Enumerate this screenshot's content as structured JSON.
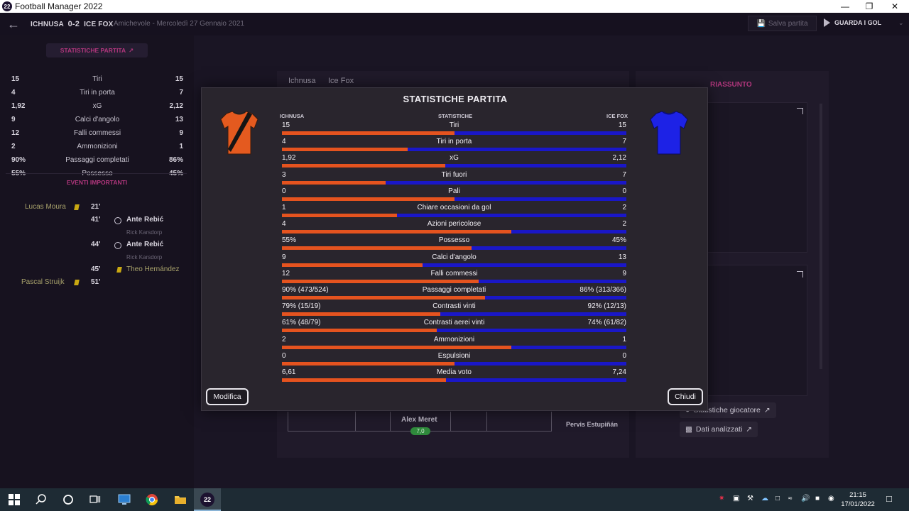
{
  "window": {
    "title": "Football Manager 2022",
    "logo_text": "22",
    "controls": [
      "—",
      "❐",
      "✕"
    ]
  },
  "topbar": {
    "home_team": "ICHNUSA",
    "score": "0-2",
    "away_team": "ICE FOX",
    "subtitle": "Amichevole - Mercoledì 27 Gennaio 2021",
    "save_label": "Salva partita",
    "watch_label": "GUARDA I GOL"
  },
  "left_panel": {
    "header": "STATISTICHE PARTITA",
    "stats": [
      {
        "home": "15",
        "label": "Tiri",
        "away": "15"
      },
      {
        "home": "4",
        "label": "Tiri in porta",
        "away": "7"
      },
      {
        "home": "1,92",
        "label": "xG",
        "away": "2,12"
      },
      {
        "home": "9",
        "label": "Calci d'angolo",
        "away": "13"
      },
      {
        "home": "12",
        "label": "Falli commessi",
        "away": "9"
      },
      {
        "home": "2",
        "label": "Ammonizioni",
        "away": "1"
      },
      {
        "home": "90%",
        "label": "Passaggi completati",
        "away": "86%"
      },
      {
        "home": "55%",
        "label": "Possesso",
        "away": "45%"
      }
    ],
    "events_header": "EVENTI IMPORTANTI",
    "events": [
      {
        "player": "Lucas Moura",
        "minute": "21'"
      },
      {
        "minute": "41'",
        "player": "Ante Rebić",
        "assist": "Rick Karsdorp"
      },
      {
        "minute": "44'",
        "player": "Ante Rebić",
        "assist": "Rick Karsdorp"
      },
      {
        "minute": "45'",
        "player": "Theo Hernández"
      },
      {
        "player": "Pascal Struijk",
        "minute": "51'"
      }
    ]
  },
  "middle": {
    "tabs": [
      "Ichnusa",
      "Ice Fox"
    ],
    "keeper_name": "Alex Meret",
    "keeper_rating": "7,0",
    "other_player": "Pervis Estupiñán"
  },
  "right_panel": {
    "title": "RIASSUNTO",
    "btn_player_stats": "Statistiche giocatore",
    "btn_analysis": "Dati analizzati"
  },
  "dialog": {
    "title": "STATISTICHE PARTITA",
    "home_header": "ICHNUSA",
    "middle_header": "STATISTICHE",
    "away_header": "ICE FOX",
    "home_color": "#e5531f",
    "away_color": "#1a17c8",
    "rows": [
      {
        "home": "15",
        "label": "Tiri",
        "away": "15",
        "share": 0.5
      },
      {
        "home": "4",
        "label": "Tiri in porta",
        "away": "7",
        "share": 0.364
      },
      {
        "home": "1,92",
        "label": "xG",
        "away": "2,12",
        "share": 0.475
      },
      {
        "home": "3",
        "label": "Tiri fuori",
        "away": "7",
        "share": 0.3
      },
      {
        "home": "0",
        "label": "Pali",
        "away": "0",
        "share": 0.5
      },
      {
        "home": "1",
        "label": "Chiare occasioni da gol",
        "away": "2",
        "share": 0.333
      },
      {
        "home": "4",
        "label": "Azioni pericolose",
        "away": "2",
        "share": 0.667
      },
      {
        "home": "55%",
        "label": "Possesso",
        "away": "45%",
        "share": 0.55
      },
      {
        "home": "9",
        "label": "Calci d'angolo",
        "away": "13",
        "share": 0.409
      },
      {
        "home": "12",
        "label": "Falli commessi",
        "away": "9",
        "share": 0.571
      },
      {
        "home": "90% (473/524)",
        "label": "Passaggi completati",
        "away": "86% (313/366)",
        "share": 0.59
      },
      {
        "home": "79% (15/19)",
        "label": "Contrasti vinti",
        "away": "92% (12/13)",
        "share": 0.46
      },
      {
        "home": "61% (48/79)",
        "label": "Contrasti aerei vinti",
        "away": "74% (61/82)",
        "share": 0.45
      },
      {
        "home": "2",
        "label": "Ammonizioni",
        "away": "1",
        "share": 0.667
      },
      {
        "home": "0",
        "label": "Espulsioni",
        "away": "0",
        "share": 0.5
      },
      {
        "home": "6,61",
        "label": "Media voto",
        "away": "7,24",
        "share": 0.477
      }
    ],
    "btn_edit": "Modifica",
    "btn_close": "Chiudi"
  },
  "taskbar": {
    "time": "21:15",
    "date": "17/01/2022",
    "fm_icon": "22"
  }
}
